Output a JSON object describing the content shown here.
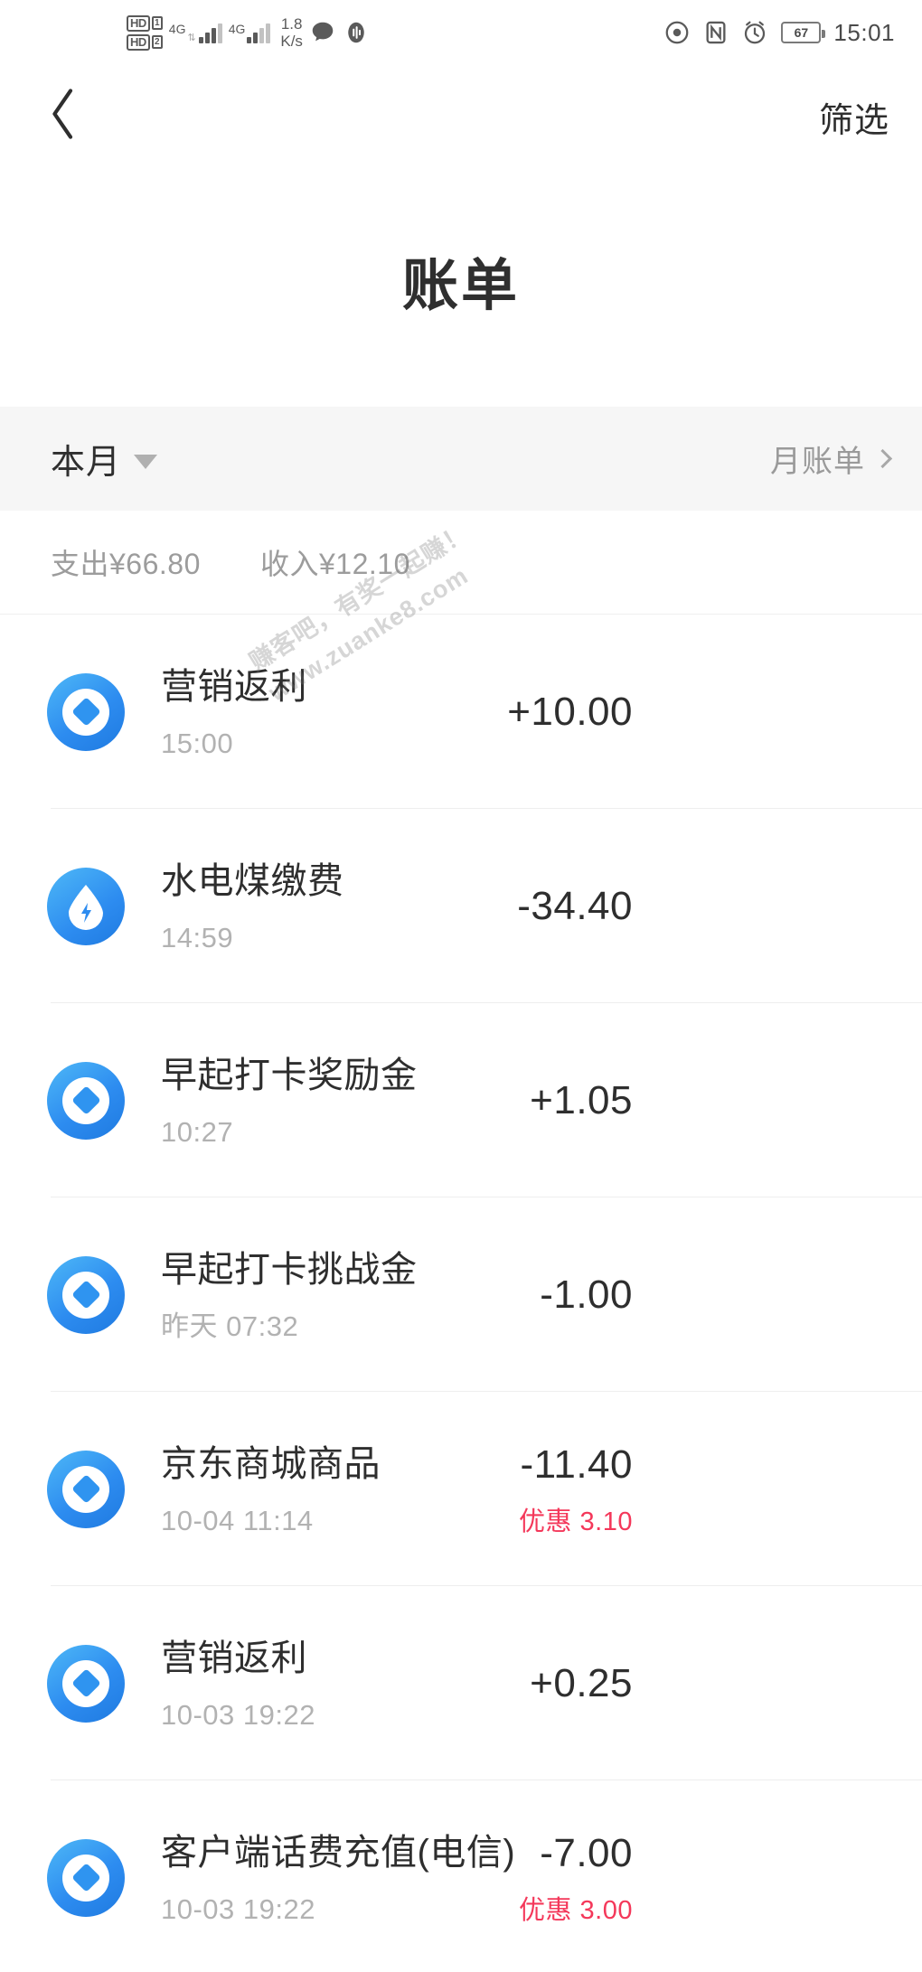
{
  "status_bar": {
    "hd1_label": "HD",
    "hd1_sub": "1",
    "hd2_label": "HD",
    "hd2_sub": "2",
    "network_1": "4G",
    "network_2": "4G",
    "net_speed_value": "1.8",
    "net_speed_unit": "K/s",
    "battery_percent": "67",
    "clock": "15:01",
    "icons": [
      "message-icon",
      "voice-assistant-icon",
      "eye-care-icon",
      "nfc-icon",
      "alarm-icon",
      "battery-icon"
    ]
  },
  "nav": {
    "back_icon": "back-chevron-icon",
    "filter_label": "筛选"
  },
  "page": {
    "title": "账单"
  },
  "month_bar": {
    "period_label": "本月",
    "monthly_bill_label": "月账单"
  },
  "summary": {
    "expense": "支出¥66.80",
    "income": "收入¥12.10"
  },
  "watermark": {
    "line1": "赚客吧，有奖一起赚！",
    "line2": "www.zuanke8.com"
  },
  "colors": {
    "accent_blue": "#2d8cf0",
    "discount_red": "#f4385a",
    "text_primary": "#2e2e2e",
    "text_muted": "#b2b2b2",
    "bar_bg": "#f6f6f6"
  },
  "transactions": [
    {
      "icon": "alipay-logo-icon",
      "icon_type": "alipay",
      "title": "营销返利",
      "time": "15:00",
      "amount": "+10.00",
      "discount": ""
    },
    {
      "icon": "water-electricity-gas-icon",
      "icon_type": "utility",
      "title": "水电煤缴费",
      "time": "14:59",
      "amount": "-34.40",
      "discount": ""
    },
    {
      "icon": "alipay-logo-icon",
      "icon_type": "alipay",
      "title": "早起打卡奖励金",
      "time": "10:27",
      "amount": "+1.05",
      "discount": ""
    },
    {
      "icon": "alipay-logo-icon",
      "icon_type": "alipay",
      "title": "早起打卡挑战金",
      "time": "昨天 07:32",
      "amount": "-1.00",
      "discount": ""
    },
    {
      "icon": "alipay-logo-icon",
      "icon_type": "alipay",
      "title": "京东商城商品",
      "time": "10-04 11:14",
      "amount": "-11.40",
      "discount": "优惠 3.10"
    },
    {
      "icon": "alipay-logo-icon",
      "icon_type": "alipay",
      "title": "营销返利",
      "time": "10-03 19:22",
      "amount": "+0.25",
      "discount": ""
    },
    {
      "icon": "alipay-logo-icon",
      "icon_type": "alipay",
      "title": "客户端话费充值(电信)",
      "time": "10-03 19:22",
      "amount": "-7.00",
      "discount": "优惠 3.00"
    }
  ]
}
